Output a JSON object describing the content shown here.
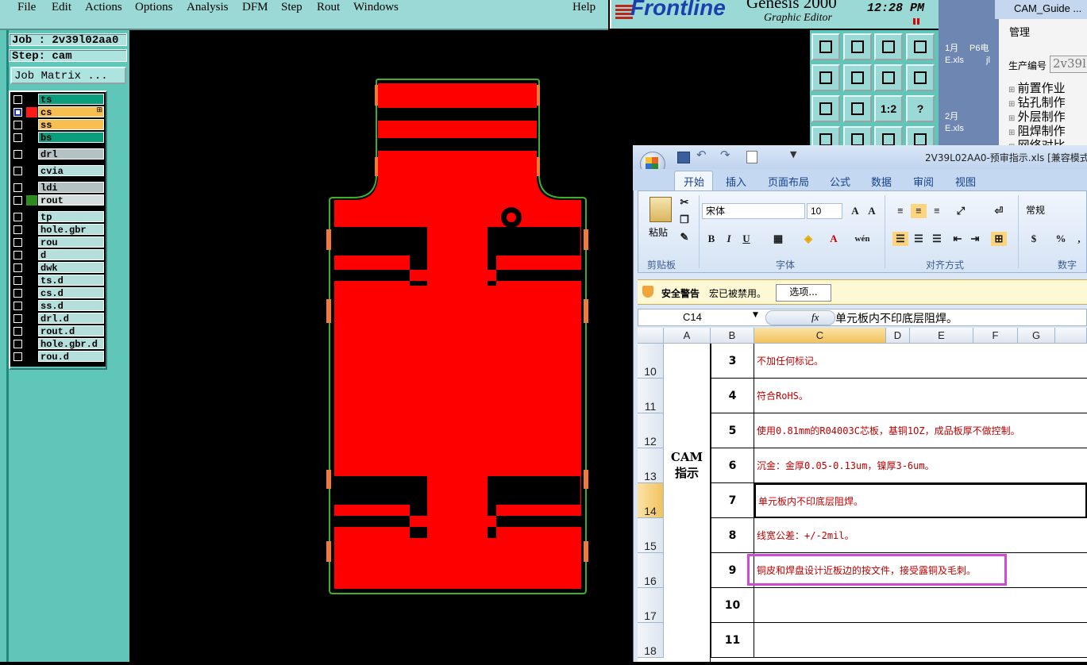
{
  "menubar": {
    "items": [
      "File",
      "Edit",
      "Actions",
      "Options",
      "Analysis",
      "DFM",
      "Step",
      "Rout",
      "Windows"
    ],
    "help": "Help"
  },
  "brand": {
    "logo": "Frontline",
    "product": "Genesis 2000",
    "subtitle": "Graphic Editor",
    "clock": "12:28 PM"
  },
  "job": {
    "job_line": "Job : 2v39l02aa0",
    "step_line": "Step: cam",
    "matrix_button": "Job Matrix ..."
  },
  "layers": [
    {
      "name": "ts",
      "color": "#0b9e7c",
      "swatch": "#000000",
      "selected": false
    },
    {
      "name": "cs",
      "color": "#f6bf4f",
      "swatch": "#ff1a1a",
      "selected": true,
      "marker": "⊞"
    },
    {
      "name": "ss",
      "color": "#f6bf4f",
      "swatch": "#000000",
      "selected": false
    },
    {
      "name": "bs",
      "color": "#0b9e7c",
      "swatch": "#000000",
      "selected": false
    },
    {
      "name": "drl",
      "color": "#b4c2c6",
      "swatch": "#000000",
      "selected": false
    },
    {
      "name": "cvia",
      "color": "#b4dfdd",
      "swatch": "#000000",
      "selected": false
    },
    {
      "name": "ldi",
      "color": "#b4c2c6",
      "swatch": "#000000",
      "selected": false
    },
    {
      "name": "rout",
      "color": "#d6dedd",
      "swatch": "#2e8b1e",
      "selected": false
    },
    {
      "name": "tp",
      "color": "#b4dfdd",
      "swatch": "#000000",
      "selected": false
    },
    {
      "name": "hole.gbr",
      "color": "#b4dfdd",
      "swatch": "#000000",
      "selected": false
    },
    {
      "name": "rou",
      "color": "#b4dfdd",
      "swatch": "#000000",
      "selected": false
    },
    {
      "name": "d",
      "color": "#b4dfdd",
      "swatch": "#000000",
      "selected": false
    },
    {
      "name": "dwk",
      "color": "#b4dfdd",
      "swatch": "#000000",
      "selected": false
    },
    {
      "name": "ts.d",
      "color": "#b4dfdd",
      "swatch": "#000000",
      "selected": false
    },
    {
      "name": "cs.d",
      "color": "#b4dfdd",
      "swatch": "#000000",
      "selected": false
    },
    {
      "name": "ss.d",
      "color": "#b4dfdd",
      "swatch": "#000000",
      "selected": false
    },
    {
      "name": "drl.d",
      "color": "#b4dfdd",
      "swatch": "#000000",
      "selected": false
    },
    {
      "name": "rout.d",
      "color": "#b4dfdd",
      "swatch": "#000000",
      "selected": false
    },
    {
      "name": "hole.gbr.d",
      "color": "#b4dfdd",
      "swatch": "#000000",
      "selected": false
    },
    {
      "name": "rou.d",
      "color": "#b4dfdd",
      "swatch": "#000000",
      "selected": false
    }
  ],
  "toolbar": {
    "icons": [
      "zoom-up-icon",
      "zoom-down-icon",
      "home-icon",
      "window-icon",
      "pan-left-icon",
      "pan-right-icon",
      "undo-view-icon",
      "redo-view-icon",
      "fit-icon",
      "center-icon",
      "one-to-two-icon",
      "help-icon",
      "measure-icon",
      "layer-icon",
      "snap-icon",
      "grid-icon"
    ],
    "ratio_label": "1:2",
    "help_label": "?"
  },
  "background": {
    "cam_guide_title": "CAM_Guide ...",
    "manage": "管理",
    "prod_no_label": "生产编号",
    "prod_no_value": "2v39l",
    "tree": [
      "前置作业",
      "钻孔制作",
      "外层制作",
      "阻焊制作",
      "网络对比"
    ],
    "desktop": [
      "1月",
      "P6电",
      "E.xls",
      "jl",
      "2月",
      "E.xls"
    ]
  },
  "excel": {
    "title": "2V39L02AA0-预审指示.xls  [兼容模式]",
    "tabs": [
      "开始",
      "插入",
      "页面布局",
      "公式",
      "数据",
      "审阅",
      "视图"
    ],
    "paste": "粘贴",
    "font_name": "宋体",
    "font_size": "10",
    "number_format": "常规",
    "groups": [
      "剪贴板",
      "字体",
      "对齐方式",
      "数字"
    ],
    "security_label": "安全警告",
    "security_msg": "宏已被禁用。",
    "options_button": "选项...",
    "name_box": "C14",
    "fx": "fx",
    "formula": "单元板内不印底层阻焊。",
    "columns": [
      "A",
      "B",
      "C",
      "D",
      "E",
      "F",
      "G"
    ],
    "a_label_line1": "CAM",
    "a_label_line2": "指示",
    "rows": [
      {
        "row": "10",
        "b": "3",
        "c": "不加任何标记。"
      },
      {
        "row": "11",
        "b": "4",
        "c": "符合RoHS。"
      },
      {
        "row": "12",
        "b": "5",
        "c": "使用0.81mm的R04003C芯板，基铜1OZ，成品板厚不做控制。"
      },
      {
        "row": "13",
        "b": "6",
        "c": "沉金：金厚0.05-0.13um，镍厚3-6um。"
      },
      {
        "row": "14",
        "b": "7",
        "c": "单元板内不印底层阻焊。"
      },
      {
        "row": "15",
        "b": "8",
        "c": "线宽公差：+/-2mil。"
      },
      {
        "row": "16",
        "b": "9",
        "c": "铜皮和焊盘设计近板边的按文件，接受露铜及毛刺。"
      },
      {
        "row": "17",
        "b": "10",
        "c": ""
      },
      {
        "row": "18",
        "b": "11",
        "c": ""
      }
    ]
  },
  "colors": {
    "copper": "#ff0000",
    "outline": "#3fae2a",
    "highlight": "#d04ad8"
  }
}
